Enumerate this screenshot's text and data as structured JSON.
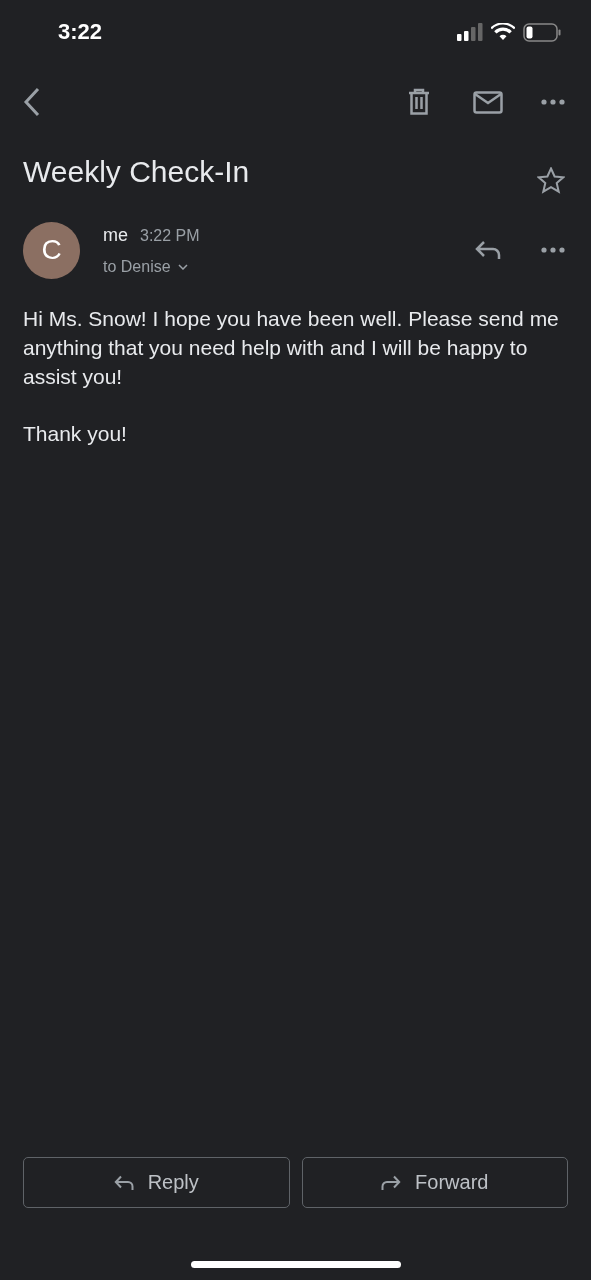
{
  "status_bar": {
    "time": "3:22"
  },
  "subject": {
    "title": "Weekly Check-In",
    "starred": false
  },
  "message": {
    "avatar_letter": "C",
    "sender": "me",
    "time": "3:22 PM",
    "recipient": "to Denise",
    "paragraphs": [
      "Hi Ms. Snow! I hope you have been well. Please send me anything that you need help with and I will be happy to assist you!",
      "Thank you!"
    ]
  },
  "actions": [
    {
      "kind": "reply",
      "label": "Reply"
    },
    {
      "kind": "forward",
      "label": "Forward"
    }
  ]
}
